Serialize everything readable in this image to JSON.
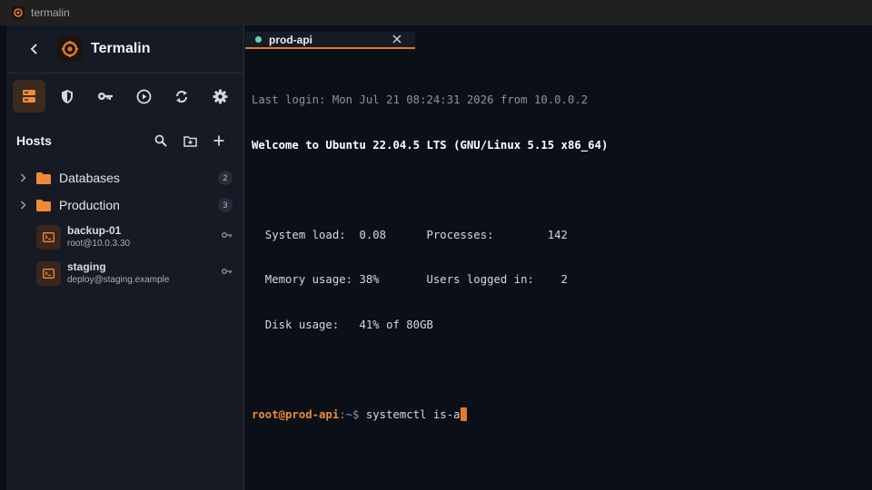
{
  "window": {
    "title": "termalin"
  },
  "sidebar": {
    "brand": "Termalin",
    "toolbar": [
      {
        "name": "hosts",
        "icon": "server-icon",
        "active": true
      },
      {
        "name": "vault",
        "icon": "shield-icon",
        "active": false
      },
      {
        "name": "keys",
        "icon": "key-icon",
        "active": false
      },
      {
        "name": "snippets",
        "icon": "play-icon",
        "active": false
      },
      {
        "name": "sync",
        "icon": "sync-icon",
        "active": false
      },
      {
        "name": "settings",
        "icon": "gear-icon",
        "active": false
      }
    ],
    "hosts_title": "Hosts",
    "folders": [
      {
        "label": "Databases",
        "count": "2"
      },
      {
        "label": "Production",
        "count": "3"
      }
    ],
    "hosts": [
      {
        "name": "backup-01",
        "address": "root@10.0.3.30"
      },
      {
        "name": "staging",
        "address": "deploy@staging.example"
      }
    ]
  },
  "tabs": [
    {
      "label": "prod-api",
      "status_color": "#5fd7b5"
    }
  ],
  "terminal": {
    "last_login": "Last login: Mon Jul 21 08:24:31 2026 from 10.0.0.2",
    "welcome": "Welcome to Ubuntu 22.04.5 LTS (GNU/Linux 5.15 x86_64)",
    "stats": [
      "  System load:  0.08      Processes:        142",
      "  Memory usage: 38%       Users logged in:    2",
      "  Disk usage:   41% of 80GB"
    ],
    "prompt_user": "root@prod-api",
    "prompt_path": ":~$",
    "command": " systemctl is-a"
  },
  "colors": {
    "accent": "#e6792b",
    "folder": "#f08a34",
    "status": "#5fd7b5"
  }
}
